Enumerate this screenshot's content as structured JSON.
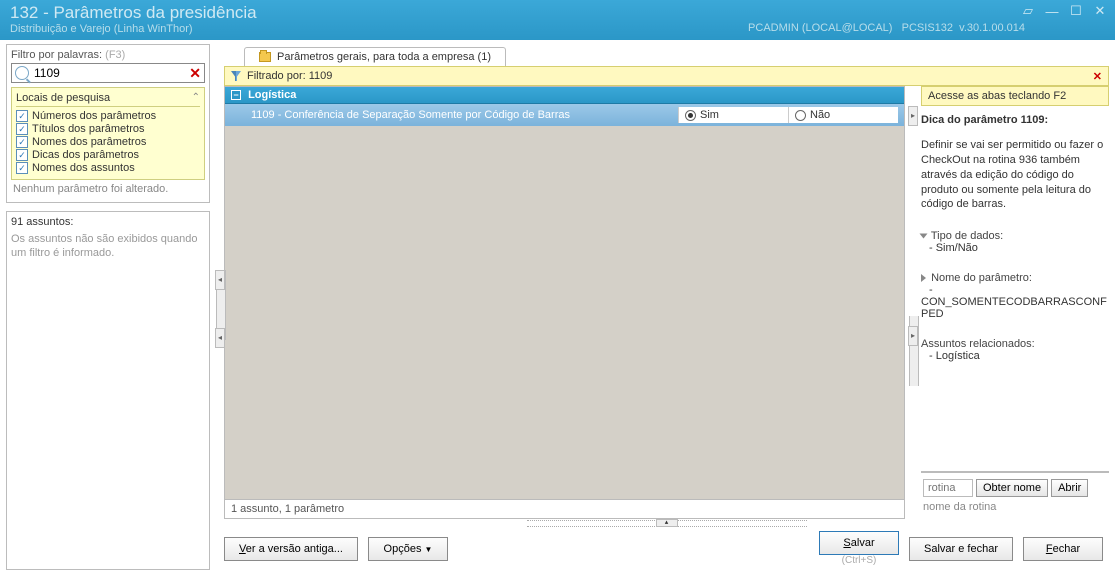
{
  "titlebar": {
    "title": "132 - Parâmetros da presidência",
    "subtitle": "Distribuição e Varejo (Linha WinThor)",
    "user": "PCADMIN (LOCAL@LOCAL)",
    "module": "PCSIS132",
    "version": "v.30.1.00.014"
  },
  "left": {
    "filter_label": "Filtro por palavras:",
    "filter_hint": "(F3)",
    "search_value": "1109",
    "locations_header": "Locais de pesquisa",
    "checks": [
      "Números dos parâmetros",
      "Títulos dos parâmetros",
      "Nomes dos parâmetros",
      "Dicas dos parâmetros",
      "Nomes dos assuntos"
    ],
    "status": "Nenhum parâmetro foi alterado.",
    "subjects_header": "91 assuntos:",
    "subjects_msg": "Os assuntos não são exibidos quando um filtro é informado."
  },
  "tab": {
    "label": "Parâmetros gerais, para toda a empresa  (1)"
  },
  "filterbar": {
    "text": "Filtrado por: 1109"
  },
  "grid": {
    "group": "Logística",
    "row_label": "1109 - Conferência de Separação Somente por Código de Barras",
    "opt_yes": "Sim",
    "opt_no": "Não",
    "footer": "1 assunto, 1 parâmetro"
  },
  "right": {
    "access_hint": "Acesse as abas teclando F2",
    "tip_title": "Dica do parâmetro 1109:",
    "tip_body": "Definir se vai ser permitido ou fazer o CheckOut na rotina 936 também através da edição do código do produto ou somente pela leitura do código de barras.",
    "datatype_label": "Tipo de dados:",
    "datatype_value": "- Sim/Não",
    "paramname_label": "Nome do parâmetro:",
    "paramname_value": "CON_SOMENTECODBARRASCONFPED",
    "related_label": "Assuntos relacionados:",
    "related_value": "- Logística",
    "routine_placeholder": "rotina",
    "btn_getname": "Obter nome",
    "btn_open": "Abrir",
    "routine_name": "nome da rotina"
  },
  "buttons": {
    "old_version": "Ver a versão antiga...",
    "options": "Opções",
    "save": "Salvar",
    "save_close": "Salvar e fechar",
    "close": "Fechar",
    "save_shortcut": "(Ctrl+S)"
  }
}
